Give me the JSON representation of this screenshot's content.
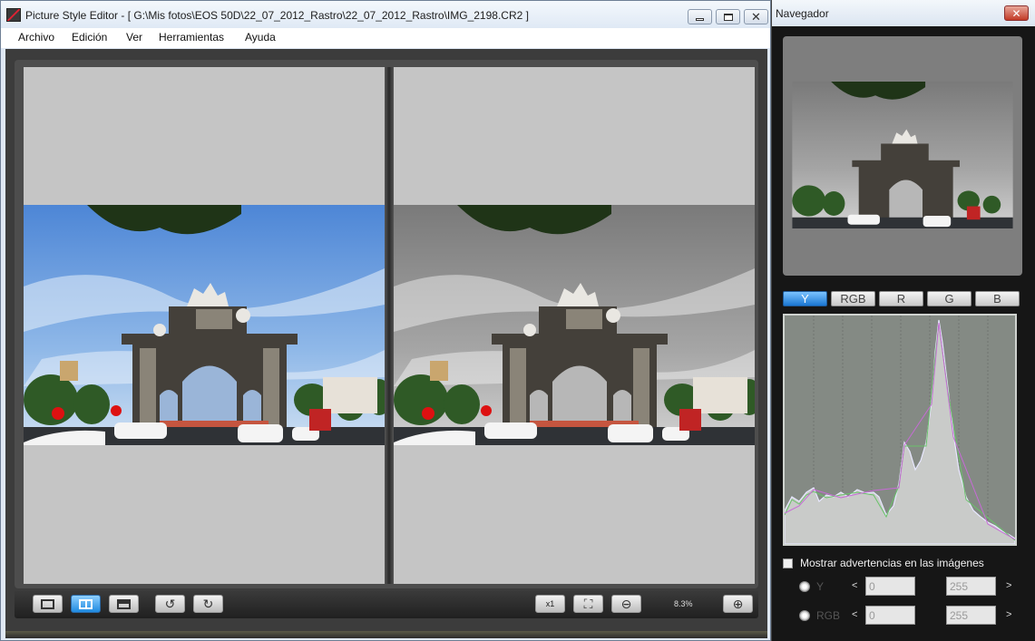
{
  "window": {
    "title": "Picture Style Editor - [ G:\\Mis fotos\\EOS 50D\\22_07_2012_Rastro\\22_07_2012_Rastro\\IMG_2198.CR2 ]",
    "minimize_icon": "minimize-icon",
    "maximize_icon": "maximize-icon",
    "close_glyph": "✕"
  },
  "menu": {
    "items": [
      "Archivo",
      "Edición",
      "Ver",
      "Herramientas",
      "Ayuda"
    ]
  },
  "toolbar": {
    "zoom_level": "8.3%",
    "fit_label": "x1",
    "active_view": "side-by-side"
  },
  "navigator": {
    "title": "Navegador",
    "close_glyph": "✕",
    "channels": [
      "Y",
      "RGB",
      "R",
      "G",
      "B"
    ],
    "active_channel": "Y",
    "warning_label": "Mostrar advertencias en las imágenes",
    "warning_checked": false,
    "ranges": [
      {
        "label": "Y",
        "min": "0",
        "max": "255",
        "lt": "<",
        "gt": ">"
      },
      {
        "label": "RGB",
        "min": "0",
        "max": "255",
        "lt": "<",
        "gt": ">"
      }
    ]
  },
  "colors": {
    "sky_original": "#5d8fd4",
    "sky_edited": "#8f8f8f",
    "histogram_bg": "#848a84",
    "active_tab": "#1a77d2"
  }
}
